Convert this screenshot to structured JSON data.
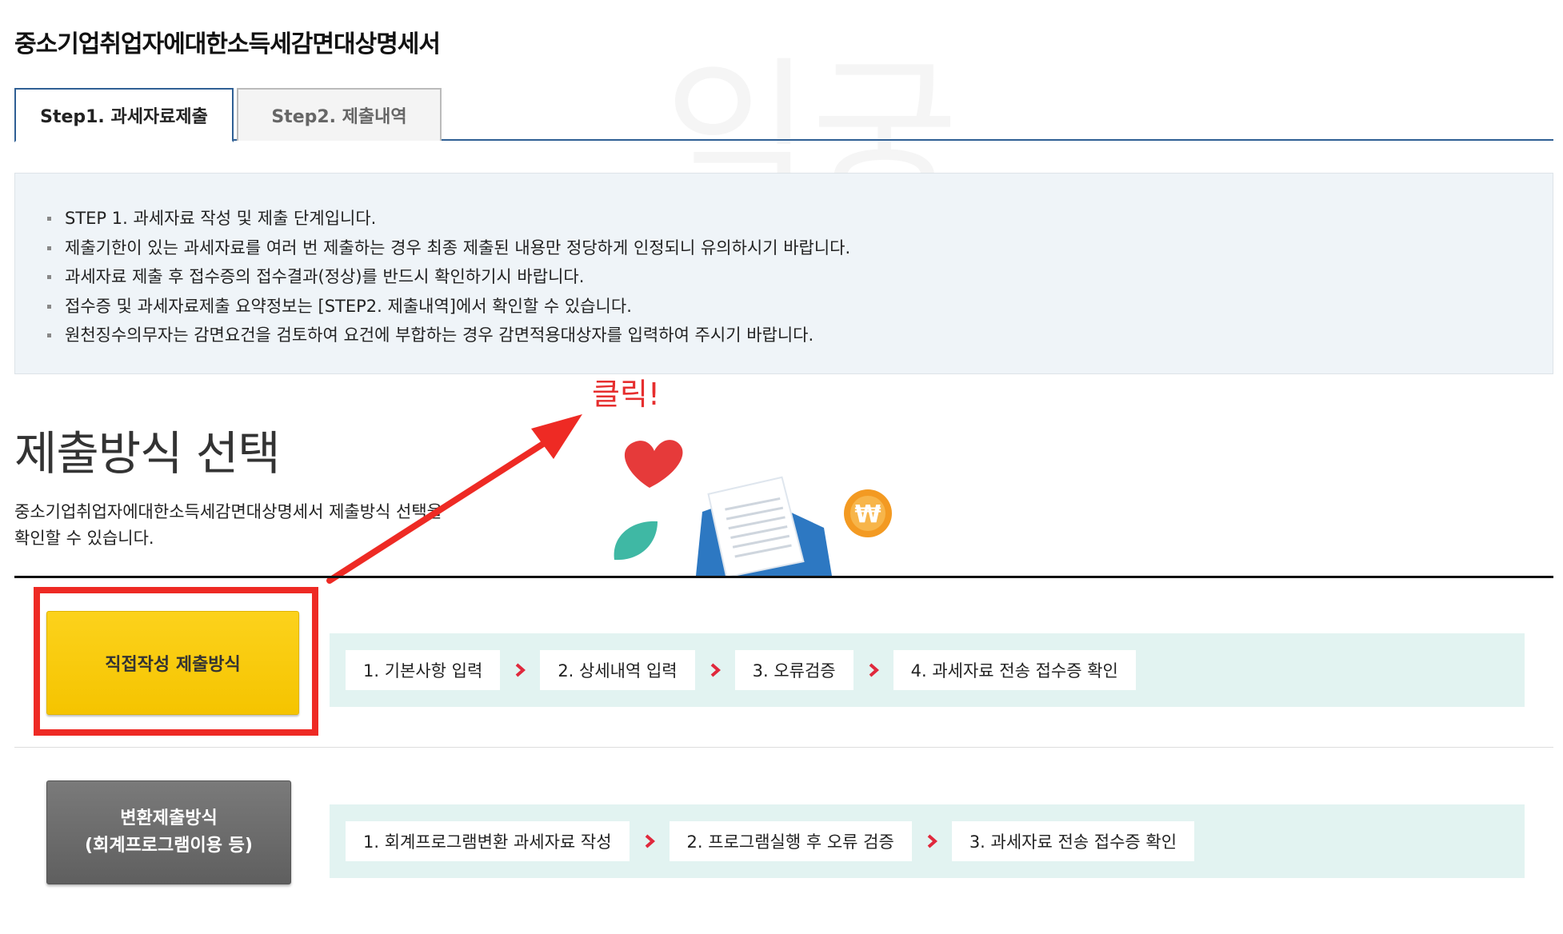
{
  "page": {
    "title": "중소기업취업자에대한소득세감면대상명세서",
    "watermark": "익궁"
  },
  "tabs": [
    {
      "label": "Step1. 과세자료제출",
      "active": true
    },
    {
      "label": "Step2. 제출내역",
      "active": false
    }
  ],
  "notice": [
    "STEP 1. 과세자료 작성 및 제출 단계입니다.",
    "제출기한이 있는 과세자료를 여러 번 제출하는 경우 최종 제출된 내용만 정당하게 인정되니 유의하시기 바랍니다.",
    "과세자료 제출 후 접수증의 접수결과(정상)를 반드시 확인하기시 바랍니다.",
    "접수증 및 과세자료제출 요약정보는 [STEP2. 제출내역]에서 확인할 수 있습니다.",
    "원천징수의무자는 감면요건을 검토하여 요건에 부합하는 경우 감면적용대상자를 입력하여 주시기 바랍니다."
  ],
  "annotation": {
    "click_label": "클릭!",
    "color": "#ee2a24"
  },
  "section": {
    "title": "제출방식 선택",
    "desc_line1": "중소기업취업자에대한소득세감면대상명세서 제출방식 선택을",
    "desc_line2": "확인할 수 있습니다."
  },
  "methods": {
    "direct": {
      "label": "직접작성 제출방식",
      "steps": [
        "1. 기본사항 입력",
        "2. 상세내역 입력",
        "3. 오류검증",
        "4. 과세자료 전송 접수증 확인"
      ]
    },
    "convert": {
      "label_line1": "변환제출방식",
      "label_line2": "(회계프로그램이용 등)",
      "steps": [
        "1. 회계프로그램변환 과세자료 작성",
        "2. 프로그램실행 후 오류 검증",
        "3. 과세자료 전송 접수증 확인"
      ]
    }
  },
  "colors": {
    "accent_blue": "#2f5f94",
    "direct_button": "#f5c400",
    "convert_button": "#6b6b6b",
    "step_bg": "#e2f3f1",
    "arrow": "#e0283c"
  }
}
